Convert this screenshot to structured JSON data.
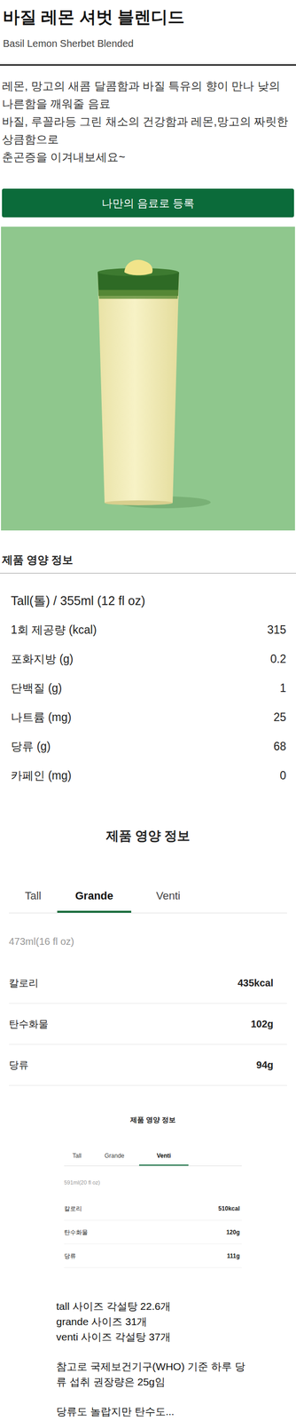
{
  "product": {
    "title": "바질 레몬 셔벗 블렌디드",
    "subtitle": "Basil Lemon Sherbet Blended",
    "description": [
      "레몬, 망고의 새콤 달콤함과 바질 특유의 향이 만나 낮의 나른함을 깨워줄 음료",
      "바질, 루꼴라등 그린 채소의 건강함과 레몬,망고의 짜릿한 상큼함으로",
      "춘곤증을 이겨내보세요~"
    ],
    "register_button": "나만의 음료로 등록"
  },
  "nutrition_tall": {
    "heading": "제품 영양 정보",
    "size": "Tall(톨) / 355ml (12 fl oz)",
    "rows": [
      {
        "label": "1회 제공량 (kcal)",
        "value": "315"
      },
      {
        "label": "포화지방 (g)",
        "value": "0.2"
      },
      {
        "label": "단백질 (g)",
        "value": "1"
      },
      {
        "label": "나트륨 (mg)",
        "value": "25"
      },
      {
        "label": "당류 (g)",
        "value": "68"
      },
      {
        "label": "카페인 (mg)",
        "value": "0"
      }
    ]
  },
  "nutrition_grande": {
    "heading": "제품 영양 정보",
    "tabs": [
      {
        "label": "Tall",
        "selected": false
      },
      {
        "label": "Grande",
        "selected": true
      },
      {
        "label": "Venti",
        "selected": false
      }
    ],
    "volume": "473ml(16 fl oz)",
    "rows": [
      {
        "label": "칼로리",
        "value": "435kcal"
      },
      {
        "label": "탄수화물",
        "value": "102g"
      },
      {
        "label": "당류",
        "value": "94g"
      }
    ]
  },
  "nutrition_venti": {
    "heading": "제품 영양 정보",
    "tabs": [
      {
        "label": "Tall",
        "selected": false
      },
      {
        "label": "Grande",
        "selected": false
      },
      {
        "label": "Venti",
        "selected": true
      }
    ],
    "volume": "591ml(20 fl oz)",
    "rows": [
      {
        "label": "칼로리",
        "value": "510kcal"
      },
      {
        "label": "탄수화물",
        "value": "120g"
      },
      {
        "label": "당류",
        "value": "111g"
      }
    ]
  },
  "notes": {
    "groups": [
      [
        "tall 사이즈 각설탕 22.6개",
        "grande 사이즈 31개",
        "venti 사이즈 각설탕 37개"
      ],
      [
        "참고로 국제보건기구(WHO) 기준 하루 당류 섭취 권장량은 25g임"
      ],
      [
        "당류도 놀랍지만 탄수도..."
      ]
    ]
  }
}
